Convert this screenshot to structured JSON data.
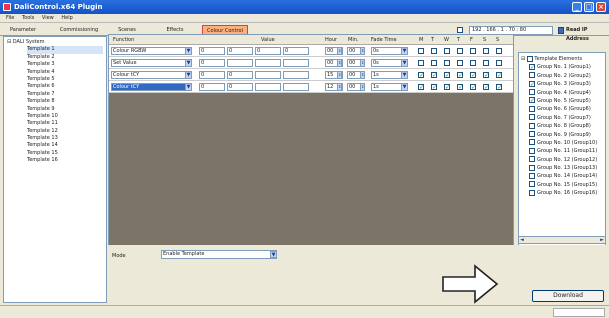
{
  "window": {
    "title": "DaliControl.x64 Plugin"
  },
  "menu": [
    "File",
    "Tools",
    "View",
    "Help"
  ],
  "tabs": [
    "Parameter",
    "Commissioning",
    "Scenes",
    "Effects",
    "Colour Control"
  ],
  "active_tab": "Colour Control",
  "address": {
    "ip": "192 . 166 . 1 . 70 : 80",
    "read_label": "Read IP Address"
  },
  "tree": {
    "root": "DALI System",
    "items": [
      "Template 1",
      "Template 2",
      "Template 3",
      "Template 4",
      "Template 5",
      "Template 6",
      "Template 7",
      "Template 8",
      "Template 9",
      "Template 10",
      "Template 11",
      "Template 12",
      "Template 13",
      "Template 14",
      "Template 15",
      "Template 16"
    ],
    "selected": "Template 1"
  },
  "table": {
    "headers": [
      "Function",
      "Value",
      "Hour",
      "Min.",
      "Fade Time",
      "M",
      "T",
      "W",
      "T",
      "F",
      "S",
      "S"
    ],
    "rows": [
      {
        "function": "Colour RGBW",
        "v1": "0",
        "v2": "0",
        "v3": "0",
        "v4": "0",
        "hour": "00",
        "min": "00",
        "fade": "0s",
        "days": [
          false,
          false,
          false,
          false,
          false,
          false,
          false
        ]
      },
      {
        "function": "Set Value",
        "v1": "0",
        "v2": "",
        "v3": "",
        "v4": "",
        "hour": "00",
        "min": "00",
        "fade": "0s",
        "days": [
          false,
          false,
          false,
          false,
          false,
          false,
          false
        ]
      },
      {
        "function": "Colour tCY",
        "v1": "0",
        "v2": "0",
        "v3": "",
        "v4": "",
        "hour": "15",
        "min": "00",
        "fade": "1s",
        "days": [
          true,
          true,
          true,
          true,
          true,
          true,
          true
        ]
      },
      {
        "function": "Colour tCY",
        "v1": "0",
        "v2": "0",
        "v3": "",
        "v4": "",
        "hour": "12",
        "min": "00",
        "fade": "1s",
        "days": [
          true,
          true,
          true,
          true,
          true,
          true,
          true
        ]
      }
    ]
  },
  "groups": {
    "root": "Template Elements",
    "items": [
      {
        "label": "Group No. 1 (Group1)",
        "checked": true
      },
      {
        "label": "Group No. 2 (Group2)",
        "checked": false
      },
      {
        "label": "Group No. 3 (Group3)",
        "checked": true
      },
      {
        "label": "Group No. 4 (Group4)",
        "checked": false
      },
      {
        "label": "Group No. 5 (Group5)",
        "checked": true
      },
      {
        "label": "Group No. 6 (Group6)",
        "checked": false
      },
      {
        "label": "Group No. 7 (Group7)",
        "checked": false
      },
      {
        "label": "Group No. 8 (Group8)",
        "checked": false
      },
      {
        "label": "Group No. 9 (Group9)",
        "checked": false
      },
      {
        "label": "Group No. 10 (Group10)",
        "checked": false
      },
      {
        "label": "Group No. 11 (Group11)",
        "checked": false
      },
      {
        "label": "Group No. 12 (Group12)",
        "checked": false
      },
      {
        "label": "Group No. 13 (Group13)",
        "checked": false
      },
      {
        "label": "Group No. 14 (Group14)",
        "checked": false
      },
      {
        "label": "Group No. 15 (Group15)",
        "checked": false
      },
      {
        "label": "Group No. 16 (Group16)",
        "checked": false
      }
    ]
  },
  "mode": {
    "label": "Mode",
    "value": "Enable Template"
  },
  "download_label": "Download",
  "icons": {
    "check": "✓",
    "arrow_down": "▼",
    "spin": "⇕"
  }
}
